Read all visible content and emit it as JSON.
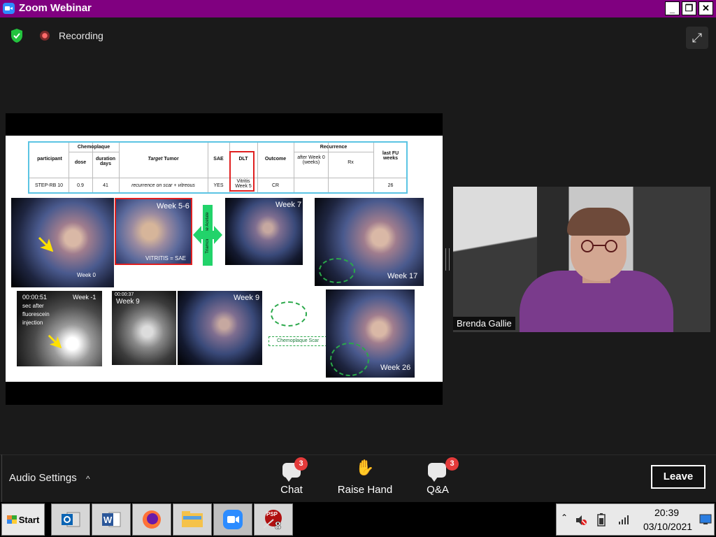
{
  "window": {
    "title": "Zoom Webinar",
    "buttons": [
      "_",
      "❐",
      "✕"
    ]
  },
  "topbar": {
    "recording_label": "Recording",
    "fullscreen_icon": "⤢"
  },
  "slide": {
    "table": {
      "headers": {
        "participant": "participant",
        "chemoplaque": "Chemoplaque",
        "dose": "dose",
        "duration": "duration days",
        "target_tumor_italic": "Target",
        "target_tumor": "Tumor",
        "sae": "SAE",
        "dlt": "DLT",
        "outcome": "Outcome",
        "recurrence": "Recurrence",
        "after_week": "after Week 0 (weeks)",
        "rx": "Rx",
        "last_fu": "last FU weeks"
      },
      "row": {
        "participant": "STEP-RB 10",
        "dose": "0.9",
        "duration": "41",
        "target": "recurrence on scar + vitreous",
        "sae": "YES",
        "dlt": "Vitritis Week 5",
        "outcome": "CR",
        "last_fu": "26"
      }
    },
    "images": {
      "week0": "Week 0",
      "week56": "Week 5-6",
      "vitritis": "VITRITIS = SAE",
      "triamcinolone": "Triamcinolone Acetate",
      "week7": "Week 7",
      "week17": "Week 17",
      "angio_time": "00:00:51",
      "angio_text": "sec after fluorescein injection",
      "week_minus1": "Week -1",
      "angio2_time": "00:00:37",
      "week9a": "Week 9",
      "week9b": "Week 9",
      "scar_label": "Chemoplaque Scar",
      "week26": "Week 26"
    }
  },
  "participant": {
    "name": "Brenda Gallie"
  },
  "controls": {
    "audio_settings": "Audio Settings",
    "caret": "^",
    "chat": {
      "label": "Chat",
      "badge": "3"
    },
    "raise_hand": {
      "label": "Raise Hand",
      "icon": "✋"
    },
    "qa": {
      "label": "Q&A",
      "badge": "3"
    },
    "leave": "Leave"
  },
  "taskbar": {
    "start": "Start",
    "apps": [
      "outlook-icon",
      "word-icon",
      "firefox-icon",
      "file-explorer-icon",
      "zoom-icon",
      "psp8-icon"
    ],
    "time": "20:39",
    "date": "03/10/2021",
    "colors": {
      "zoom_blue": "#2d8cff",
      "title_purple": "#800080",
      "badge_red": "#e43a3a"
    }
  }
}
